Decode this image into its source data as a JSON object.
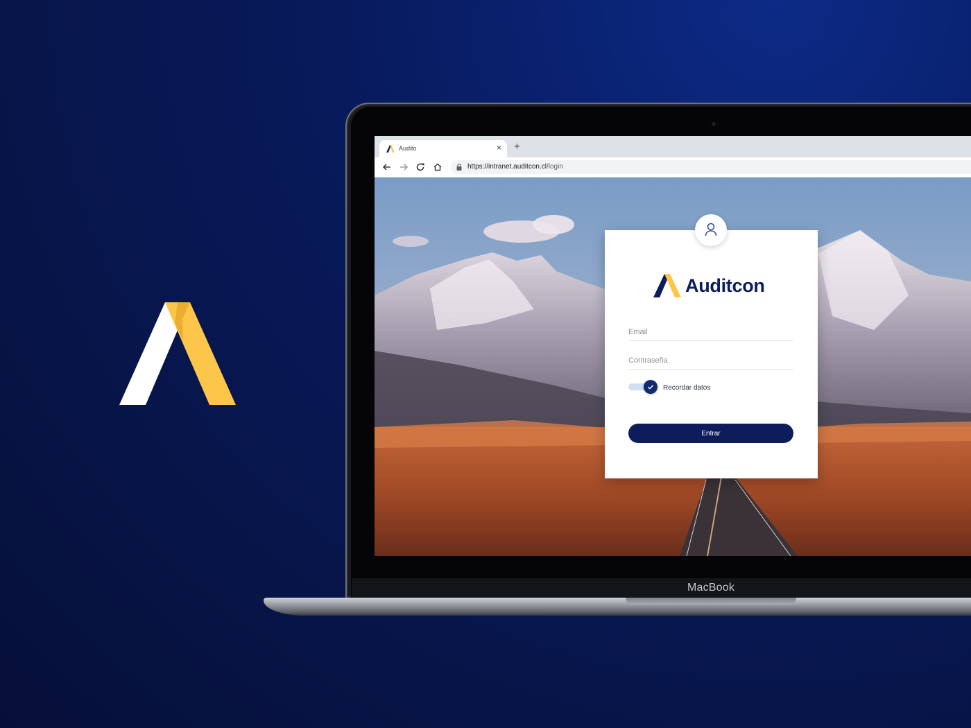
{
  "browser": {
    "tab_title": "Audito",
    "tab_close": "×",
    "new_tab": "+",
    "url_host": "https://intranet.auditcon.cl",
    "url_path": "/login"
  },
  "login": {
    "brand_name": "Auditcon",
    "email_placeholder": "Email",
    "password_placeholder": "Contraseña",
    "remember_label": "Recordar datos",
    "remember_checked": true,
    "submit_label": "Entrar"
  },
  "device": {
    "label": "MacBook"
  },
  "colors": {
    "background": "#071446",
    "brand_navy": "#0d1d5c",
    "brand_yellow": "#fcc64a",
    "toggle_track": "#cfe0f4"
  }
}
